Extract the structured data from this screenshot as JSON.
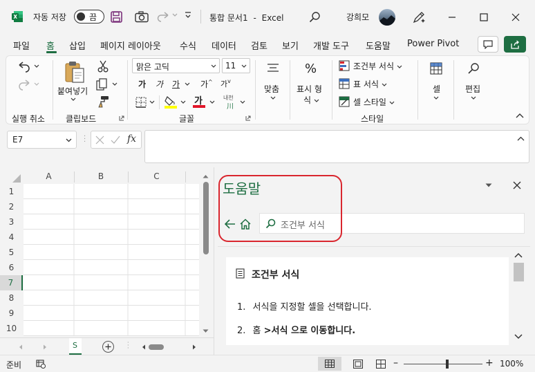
{
  "titlebar": {
    "autosave_label": "자동 저장",
    "autosave_state": "끔",
    "doc_title": "통합 문서1",
    "app_separator": "-",
    "app_name": "Excel",
    "user_name": "강희모"
  },
  "tabs": [
    {
      "label": "파일"
    },
    {
      "label": "홈",
      "active": true
    },
    {
      "label": "삽입"
    },
    {
      "label": "페이지 레이아웃"
    },
    {
      "label": "수식"
    },
    {
      "label": "데이터"
    },
    {
      "label": "검토"
    },
    {
      "label": "보기"
    },
    {
      "label": "개발 도구"
    },
    {
      "label": "도움말"
    },
    {
      "label": "Power Pivot"
    }
  ],
  "ribbon": {
    "undo_group": "실행 취소",
    "clipboard": {
      "paste": "붙여넣기",
      "group": "클립보드"
    },
    "font": {
      "name": "맑은 고딕",
      "size": "11",
      "bold": "가",
      "italic": "가",
      "underline": "가",
      "grow": "가",
      "shrink": "가",
      "highlight": "가",
      "phonetic": "내천",
      "group": "글꼴"
    },
    "align": {
      "label": "맞춤"
    },
    "number": {
      "line1": "표시 형",
      "line2": "식"
    },
    "styles": {
      "conditional": "조건부 서식",
      "table": "표 서식",
      "cell_styles": "셀 스타일",
      "group": "스타일"
    },
    "cells": {
      "label": "셀"
    },
    "editing": {
      "label": "편집"
    }
  },
  "formula_bar": {
    "name_box": "E7",
    "fx": "fx",
    "content": ""
  },
  "sheet": {
    "columns": [
      "A",
      "B",
      "C"
    ],
    "rows": [
      "1",
      "2",
      "3",
      "4",
      "5",
      "6",
      "7",
      "8",
      "9",
      "10"
    ],
    "selected_row": "7",
    "sheet_tab": "S"
  },
  "help_pane": {
    "title": "도움말",
    "search_query": "조건부 서식",
    "article_title": "조건부 서식",
    "steps": [
      {
        "num": "1.",
        "text": "서식을 지정할 셀을 선택합니다."
      },
      {
        "num": "2.",
        "text_plain": "홈 ",
        "text_bold": ">서식 으로 이동합니다."
      }
    ]
  },
  "statusbar": {
    "status": "준비",
    "zoom": "100%",
    "zoom_level": 1.0
  },
  "colors": {
    "excel_green": "#1e6e42",
    "annotation_red": "#d9262e"
  }
}
